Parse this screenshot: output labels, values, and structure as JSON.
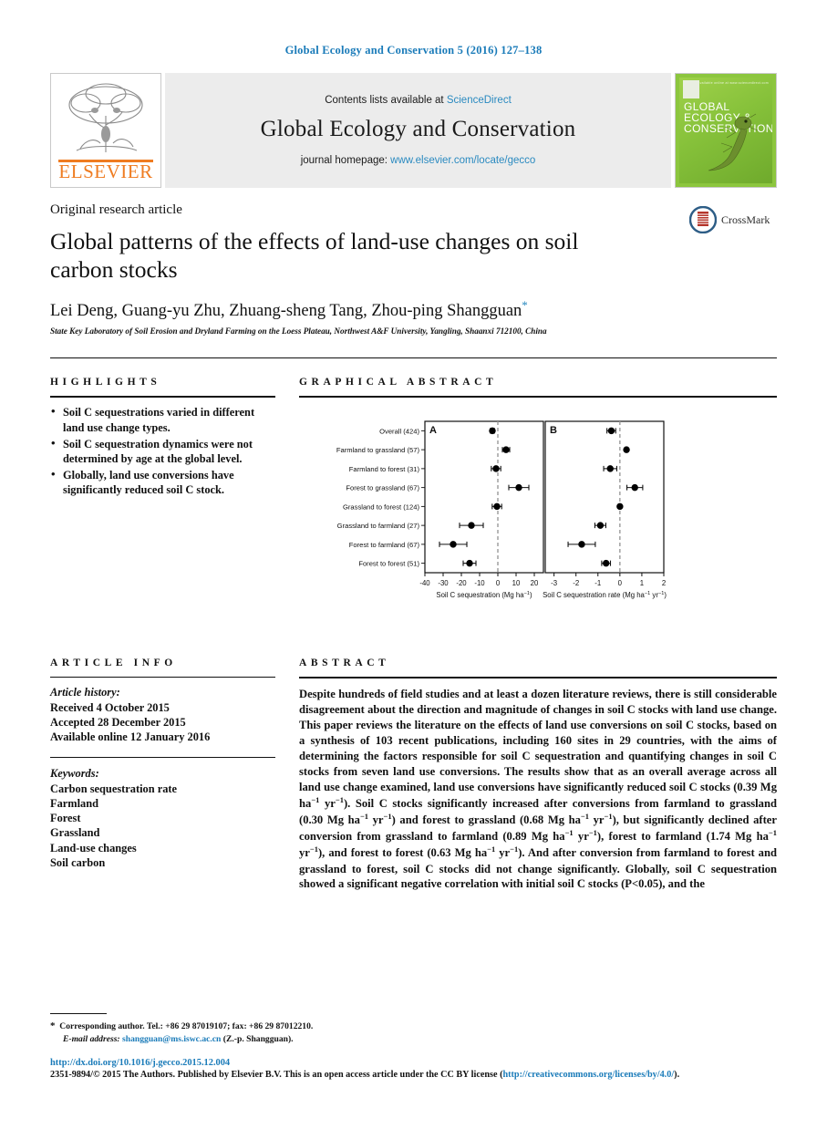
{
  "running_head": "Global Ecology and Conservation 5 (2016) 127–138",
  "masthead": {
    "contents_prefix": "Contents lists available at ",
    "contents_link": "ScienceDirect",
    "journal_title": "Global Ecology and Conservation",
    "homepage_prefix": "journal homepage: ",
    "homepage_link": "www.elsevier.com/locate/gecco",
    "publisher_logo_text": "ELSEVIER",
    "cover_title_line1": "GLOBAL",
    "cover_title_line2": "ECOLOGY &",
    "cover_title_line3": "CONSERVATION",
    "cover_corner_note": "Available online at www.sciencedirect.com"
  },
  "article": {
    "type": "Original research article",
    "title": "Global patterns of the effects of land-use changes on soil carbon stocks",
    "authors": "Lei Deng, Guang-yu Zhu, Zhuang-sheng Tang, Zhou-ping Shangguan",
    "author_star": "*",
    "affiliation": "State Key Laboratory of Soil Erosion and Dryland Farming on the Loess Plateau, Northwest A&F University, Yangling, Shaanxi 712100, China",
    "crossmark_label": "CrossMark"
  },
  "highlights": {
    "heading": "HIGHLIGHTS",
    "items": [
      "Soil C sequestrations varied in different land use change types.",
      "Soil C sequestration dynamics were not determined by age at the global level.",
      "Globally, land use conversions have significantly reduced soil C stock."
    ]
  },
  "graphical_abstract": {
    "heading": "GRAPHICAL ABSTRACT"
  },
  "chart_data": {
    "type": "scatter",
    "title": "",
    "panels": [
      {
        "label": "A",
        "xlabel": "Soil C sequestration (Mg ha−1)",
        "xlabel_base": "Soil C sequestration (Mg ha",
        "xlabel_sup": "−1",
        "xlabel_tail": ")",
        "xlim": [
          -40,
          25
        ],
        "xticks": [
          -40,
          -30,
          -20,
          -10,
          0,
          10,
          20
        ],
        "xticklabels": [
          "-40",
          "-30",
          "-20",
          "-10",
          "0",
          "10",
          "20"
        ],
        "reference_line": 0,
        "values": [
          -3.0,
          4.5,
          -1.0,
          11.5,
          -0.5,
          -14.5,
          -24.5,
          -15.5
        ],
        "errors": [
          1.2,
          2.0,
          2.6,
          5.5,
          2.6,
          6.5,
          7.5,
          3.5
        ]
      },
      {
        "label": "B",
        "xlabel": "Soil C sequestration rate (Mg ha−1 yr−1)",
        "xlabel_base": "Soil C sequestration rate (Mg ha",
        "xlabel_sup": "−1",
        "xlabel_mid": " yr",
        "xlabel_sup2": "−1",
        "xlabel_tail": ")",
        "xlim": [
          -3.4,
          2.0
        ],
        "xticks": [
          -3,
          -2,
          -1,
          0,
          1,
          2
        ],
        "xticklabels": [
          "-3",
          "-2",
          "-1",
          "0",
          "1",
          "2"
        ],
        "reference_line": 0,
        "values": [
          -0.39,
          0.3,
          -0.44,
          0.68,
          0.0,
          -0.89,
          -1.74,
          -0.63
        ],
        "errors": [
          0.2,
          0.05,
          0.3,
          0.36,
          0.03,
          0.25,
          0.62,
          0.2
        ]
      }
    ],
    "categories": [
      "Overall (424)",
      "Farmland to grassland (57)",
      "Farmland to forest (31)",
      "Forest to grassland (67)",
      "Grassland to forest (124)",
      "Grassland to farmland (27)",
      "Forest to farmland (67)",
      "Forest to forest (51)"
    ],
    "ylabel": "",
    "grid": false,
    "legend": "none",
    "marker_color": "#000000",
    "refline_color": "#9a9a9a"
  },
  "article_info": {
    "heading": "ARTICLE INFO",
    "history_label": "Article history:",
    "history": [
      "Received 4 October 2015",
      "Accepted 28 December 2015",
      "Available online 12 January 2016"
    ],
    "keywords_label": "Keywords:",
    "keywords": [
      "Carbon sequestration rate",
      "Farmland",
      "Forest",
      "Grassland",
      "Land-use changes",
      "Soil carbon"
    ]
  },
  "abstract": {
    "heading": "ABSTRACT",
    "part1": "Despite hundreds of field studies and at least a dozen literature reviews, there is still considerable disagreement about the direction and magnitude of changes in soil C stocks with land use change. This paper reviews the literature on the effects of land use conversions on soil C stocks, based on a synthesis of 103 recent publications, including 160 sites in 29 countries, with the aims of determining the factors responsible for soil C sequestration and quantifying changes in soil C stocks from seven land use conversions. The results show that as an overall average across all land use change examined, land use conversions have significantly reduced soil C stocks (0.39 Mg ha",
    "part2": " yr",
    "part3": "). Soil C stocks significantly increased after conversions from farmland to grassland (0.30 Mg ha",
    "part4": " yr",
    "part5": ") and forest to grassland (0.68 Mg ha",
    "part6": " yr",
    "part7": "), but significantly declined after conversion from grassland to farmland (0.89 Mg ha",
    "part8": " yr",
    "part9": "), forest to farmland (1.74 Mg ha",
    "part10": " yr",
    "part11": "), and forest to forest (0.63 Mg ha",
    "part12": " yr",
    "part13": "). And after conversion from farmland to forest and grassland to forest, soil C stocks did not change significantly. Globally, soil C sequestration showed a significant negative correlation with initial soil C stocks (P<0.05), and the",
    "sup": "−1"
  },
  "footer": {
    "corresponding": "Corresponding author. Tel.: +86 29 87019107; fax: +86 29 87012210.",
    "email_label": "E-mail address:",
    "email": "shangguan@ms.iswc.ac.cn",
    "email_suffix": "(Z.-p. Shangguan).",
    "doi": "http://dx.doi.org/10.1016/j.gecco.2015.12.004",
    "license_prefix": "2351-9894/© 2015 The Authors. Published by Elsevier B.V. This is an open access article under the CC BY license (",
    "license_link": "http://creativecommons.org/licenses/by/4.0/",
    "license_suffix": ")."
  }
}
